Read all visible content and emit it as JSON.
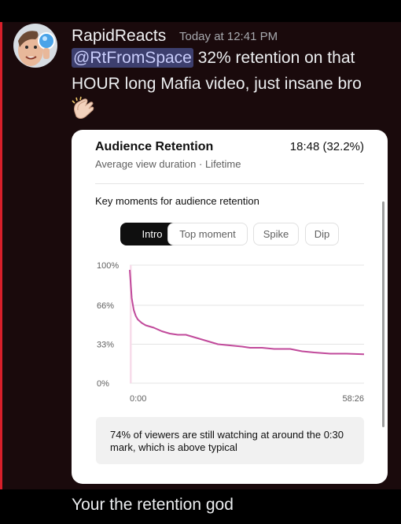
{
  "message": {
    "author": "RapidReacts",
    "timestamp": "Today at 12:41 PM",
    "mention": "@RtFromSpace",
    "text_line1": " 32% retention on that",
    "text_line2": "HOUR long Mafia video, just insane bro",
    "emoji": "clapping-hands-icon"
  },
  "card": {
    "title": "Audience Retention",
    "metric": "18:48 (32.2%)",
    "subtitle": "Average view duration · Lifetime",
    "key_moments_title": "Key moments for audience retention",
    "tabs": [
      {
        "label": "Intro",
        "active": true
      },
      {
        "label": "Top moment",
        "active": false
      },
      {
        "label": "Spike",
        "active": false
      },
      {
        "label": "Dip",
        "active": false
      }
    ],
    "callout": "74% of viewers are still watching at around the 0:30 mark, which is above typical"
  },
  "chart_data": {
    "type": "line",
    "title": "",
    "xlabel": "",
    "ylabel": "",
    "x_tick_labels": [
      "0:00",
      "58:26"
    ],
    "y_tick_labels": [
      "100%",
      "66%",
      "33%",
      "0%"
    ],
    "x": [
      0,
      0.5,
      1,
      1.5,
      2,
      3,
      4,
      5,
      6,
      8,
      10,
      12,
      14,
      16,
      18,
      20,
      22,
      25,
      28,
      30,
      33,
      36,
      40,
      43,
      46,
      50,
      54,
      58.43
    ],
    "series": [
      {
        "values": [
          96,
          72,
          62,
          57,
          54,
          51,
          49,
          48,
          47,
          44,
          42,
          41,
          41,
          39,
          37,
          35,
          33,
          32,
          31,
          30,
          30,
          29,
          29,
          27,
          26,
          25,
          25,
          24.5
        ],
        "color": "#c14a9b"
      }
    ],
    "ylim": [
      0,
      100
    ],
    "xlim": [
      0,
      58.43
    ],
    "grid": true
  },
  "reply": {
    "text": "Your the retention god"
  }
}
